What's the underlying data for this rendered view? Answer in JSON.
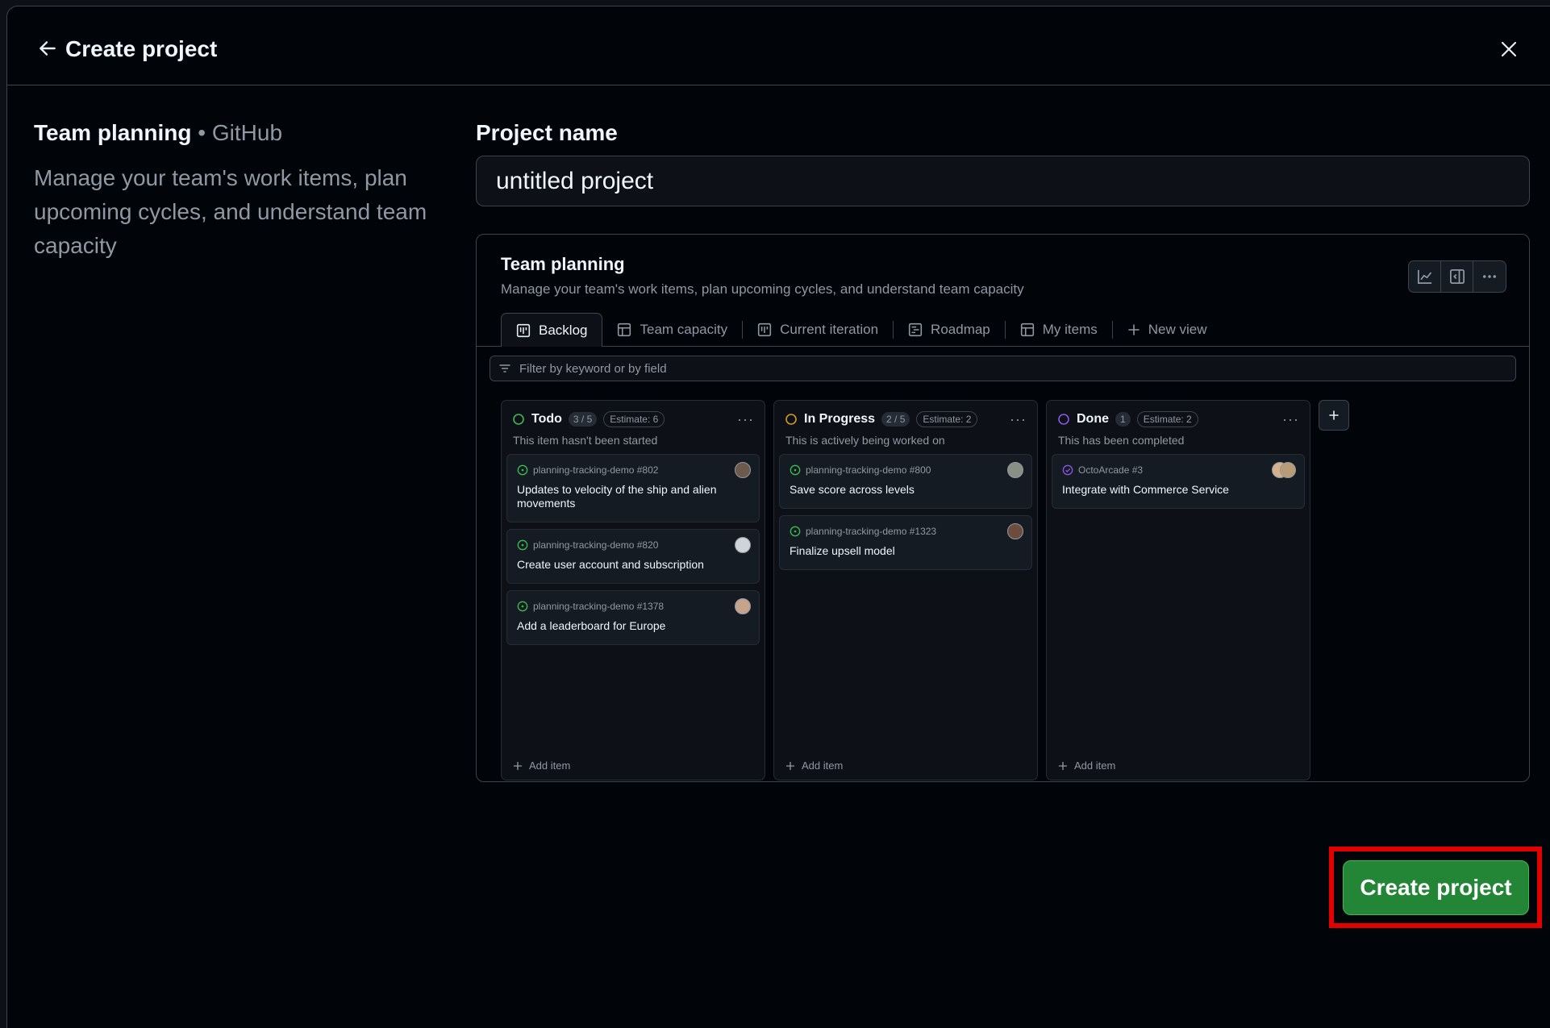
{
  "dialog": {
    "title": "Create project",
    "back_icon": "arrow-left-icon",
    "close_icon": "x-icon"
  },
  "template": {
    "name": "Team planning",
    "separator": "•",
    "owner": "GitHub",
    "description": "Manage your team's work items, plan upcoming cycles, and understand team capacity"
  },
  "form": {
    "project_name_label": "Project name",
    "project_name_value": "untitled project"
  },
  "preview": {
    "title": "Team planning",
    "description": "Manage your team's work items, plan upcoming cycles, and understand team capacity",
    "tools": [
      "graph-icon",
      "sidebar-icon",
      "kebab-horizontal-icon"
    ],
    "tabs": [
      {
        "label": "Backlog",
        "icon": "board-icon"
      },
      {
        "label": "Team capacity",
        "icon": "table-icon"
      },
      {
        "label": "Current iteration",
        "icon": "board-icon"
      },
      {
        "label": "Roadmap",
        "icon": "roadmap-icon"
      },
      {
        "label": "My items",
        "icon": "table-icon"
      },
      {
        "label": "New view",
        "icon": "plus-icon"
      }
    ],
    "filter_placeholder": "Filter by keyword or by field",
    "columns": [
      {
        "name": "Todo",
        "status_color": "#3fb950",
        "count": "3 / 5",
        "estimate": "Estimate: 6",
        "description": "This item hasn't been started",
        "add_label": "Add item",
        "cards": [
          {
            "repo": "planning-tracking-demo #802",
            "title": "Updates to velocity of the ship and alien movements"
          },
          {
            "repo": "planning-tracking-demo #820",
            "title": "Create user account and subscription"
          },
          {
            "repo": "planning-tracking-demo #1378",
            "title": "Add a leaderboard for Europe"
          }
        ]
      },
      {
        "name": "In Progress",
        "status_color": "#d29922",
        "count": "2 / 5",
        "estimate": "Estimate: 2",
        "description": "This is actively being worked on",
        "add_label": "Add item",
        "cards": [
          {
            "repo": "planning-tracking-demo #800",
            "title": "Save score across levels"
          },
          {
            "repo": "planning-tracking-demo #1323",
            "title": "Finalize upsell model"
          }
        ]
      },
      {
        "name": "Done",
        "status_color": "#8957e5",
        "count": "1",
        "estimate": "Estimate: 2",
        "description": "This has been completed",
        "add_label": "Add item",
        "cards": [
          {
            "repo": "OctoArcade #3",
            "title": "Integrate with Commerce Service"
          }
        ]
      }
    ]
  },
  "actions": {
    "create_label": "Create project"
  },
  "colors": {
    "primary_button": "#238636",
    "highlight": "#e30000"
  }
}
